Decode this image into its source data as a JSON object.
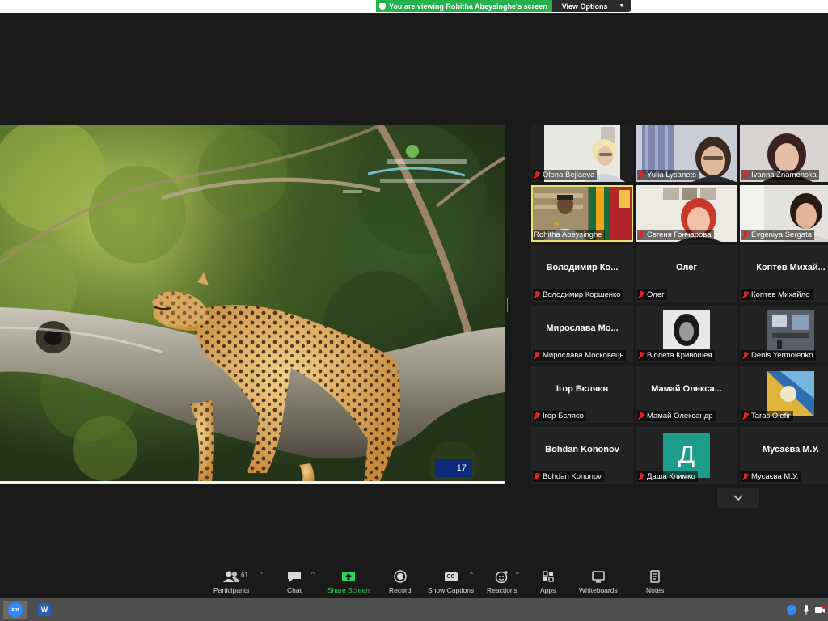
{
  "banner": {
    "viewing_text": "You are viewing Rohitha Abeysinghe's screen",
    "view_options_label": "View Options"
  },
  "share": {
    "slide_number": "17"
  },
  "gallery": {
    "tiles": [
      {
        "name": "Olena Bejlaeva",
        "type": "video"
      },
      {
        "name": "Yulia Lysanets",
        "type": "video"
      },
      {
        "name": "Ivanna Znamenska",
        "type": "video"
      },
      {
        "name": "Rohitha Abeysinghe",
        "type": "video",
        "active": true
      },
      {
        "name": "Євгеня Гончарова",
        "type": "video"
      },
      {
        "name": "Evgeniya Sergata",
        "type": "video"
      },
      {
        "name": "Володимир Коршенко",
        "display": "Володимир Ко...",
        "type": "text"
      },
      {
        "name": "Олег",
        "display": "Олег",
        "type": "text"
      },
      {
        "name": "Коптев Михайло",
        "display": "Коптев Михай...",
        "type": "text"
      },
      {
        "name": "Мирослава Московець",
        "display": "Мирослава Мо...",
        "type": "text"
      },
      {
        "name": "Віолета Кривошея",
        "type": "photo"
      },
      {
        "name": "Denis Yermolenko",
        "type": "photo"
      },
      {
        "name": "Ігор Бєляєв",
        "display": "Ігор Бєляєв",
        "type": "text"
      },
      {
        "name": "Мамай Олександр",
        "display": "Мамай Олекса...",
        "type": "text"
      },
      {
        "name": "Taras Olefir",
        "type": "photo"
      },
      {
        "name": "Bohdan Kononov",
        "display": "Bohdan Kononov",
        "type": "text"
      },
      {
        "name": "Даша Климко",
        "avatar_letter": "Д",
        "type": "avatar"
      },
      {
        "name": "Мусаєва М.У.",
        "display": "Мусаєва М.У.",
        "type": "text"
      }
    ]
  },
  "toolbar": {
    "participants_label": "Participants",
    "participants_count": "61",
    "chat_label": "Chat",
    "share_label": "Share Screen",
    "record_label": "Record",
    "captions_label": "Show Captions",
    "captions_icon_text": "CC",
    "reactions_label": "Reactions",
    "apps_label": "Apps",
    "whiteboards_label": "Whiteboards",
    "notes_label": "Notes"
  },
  "taskbar": {
    "zoom_icon_text": "zm",
    "word_icon_text": "W"
  },
  "colors": {
    "banner_green": "#23b24b",
    "active_outline": "#e8e36a",
    "avatar_teal": "#1d9c8b",
    "share_green": "#2fd45b",
    "muted_red": "#e02424"
  }
}
